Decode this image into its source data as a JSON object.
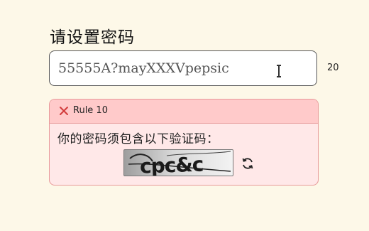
{
  "page": {
    "title": "请设置密码"
  },
  "password": {
    "value": "55555A?mayXXXVpepsic",
    "length": "20"
  },
  "rule": {
    "name": "Rule 10",
    "description": "你的密码须包含以下验证码：",
    "captcha_text": "cpc&c",
    "status": "failed",
    "status_color": "#d23b3b"
  },
  "icons": {
    "status": "close-icon",
    "refresh": "refresh-icon",
    "cursor": "text-cursor-icon"
  }
}
